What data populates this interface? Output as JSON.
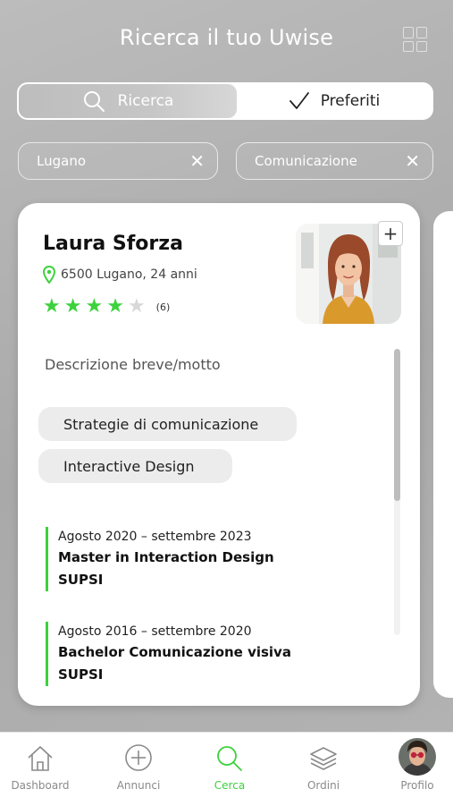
{
  "header": {
    "title": "Ricerca il tuo Uwise"
  },
  "segmented": {
    "search_label": "Ricerca",
    "favorites_label": "Preferiti"
  },
  "filters": [
    {
      "label": "Lugano"
    },
    {
      "label": "Comunicazione"
    }
  ],
  "profile": {
    "name": "Laura Sforza",
    "location": "6500 Lugano, 24 anni",
    "rating_stars": 4,
    "rating_max": 5,
    "rating_count": "(6)",
    "motto": "Descrizione breve/motto",
    "tags": [
      "Strategie di comunicazione",
      "Interactive Design"
    ],
    "education": [
      {
        "date": "Agosto 2020 – settembre 2023",
        "degree": "Master in Interaction Design",
        "school": "SUPSI"
      },
      {
        "date": "Agosto 2016 – settembre 2020",
        "degree": "Bachelor Comunicazione visiva",
        "school": "SUPSI"
      }
    ]
  },
  "tabbar": {
    "items": [
      {
        "label": "Dashboard",
        "icon": "home-icon"
      },
      {
        "label": "Annunci",
        "icon": "plus-circle-icon"
      },
      {
        "label": "Cerca",
        "icon": "search-icon"
      },
      {
        "label": "Ordini",
        "icon": "layers-icon"
      },
      {
        "label": "Profilo",
        "icon": "avatar"
      }
    ],
    "active": "Cerca"
  },
  "colors": {
    "accent": "#3dd23d",
    "background": "#b5b5b5"
  }
}
